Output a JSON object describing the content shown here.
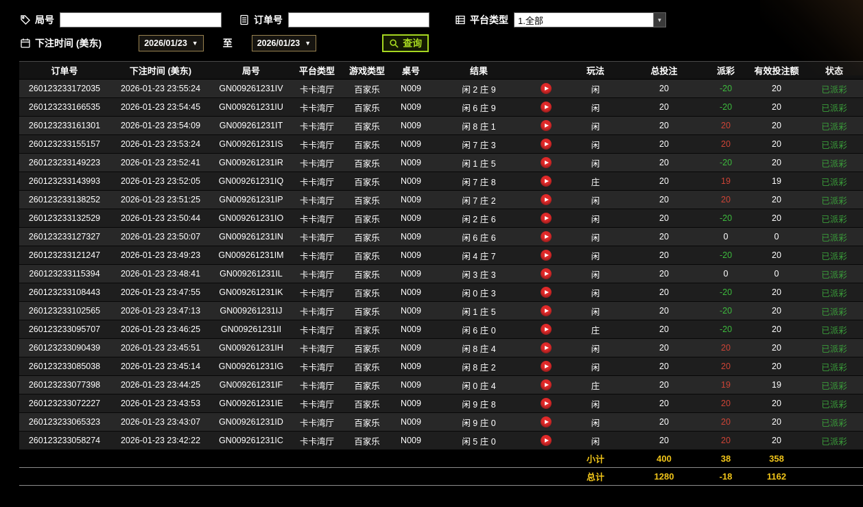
{
  "filters": {
    "round_label": "局号",
    "order_label": "订单号",
    "platform_label": "平台类型",
    "platform_value": "1.全部",
    "bet_time_label": "下注时间 (美东)",
    "date_from": "2026/01/23",
    "to_label": "至",
    "date_to": "2026/01/23",
    "query_label": "查询"
  },
  "table": {
    "headers": [
      "订单号",
      "下注时间 (美东)",
      "局号",
      "平台类型",
      "游戏类型",
      "桌号",
      "结果",
      "",
      "玩法",
      "总投注",
      "派彩",
      "有效投注额",
      "状态"
    ],
    "rows": [
      {
        "order": "260123233172035",
        "time": "2026-01-23 23:55:24",
        "round": "GN009261231IV",
        "platform": "卡卡湾厅",
        "game": "百家乐",
        "table_no": "N009",
        "result": "闲 2 庄 9",
        "play": "闲",
        "total": "20",
        "payout": "-20",
        "valid": "20",
        "status": "已派彩"
      },
      {
        "order": "260123233166535",
        "time": "2026-01-23 23:54:45",
        "round": "GN009261231IU",
        "platform": "卡卡湾厅",
        "game": "百家乐",
        "table_no": "N009",
        "result": "闲 6 庄 9",
        "play": "闲",
        "total": "20",
        "payout": "-20",
        "valid": "20",
        "status": "已派彩"
      },
      {
        "order": "260123233161301",
        "time": "2026-01-23 23:54:09",
        "round": "GN009261231IT",
        "platform": "卡卡湾厅",
        "game": "百家乐",
        "table_no": "N009",
        "result": "闲 8 庄 1",
        "play": "闲",
        "total": "20",
        "payout": "20",
        "valid": "20",
        "status": "已派彩"
      },
      {
        "order": "260123233155157",
        "time": "2026-01-23 23:53:24",
        "round": "GN009261231IS",
        "platform": "卡卡湾厅",
        "game": "百家乐",
        "table_no": "N009",
        "result": "闲 7 庄 3",
        "play": "闲",
        "total": "20",
        "payout": "20",
        "valid": "20",
        "status": "已派彩"
      },
      {
        "order": "260123233149223",
        "time": "2026-01-23 23:52:41",
        "round": "GN009261231IR",
        "platform": "卡卡湾厅",
        "game": "百家乐",
        "table_no": "N009",
        "result": "闲 1 庄 5",
        "play": "闲",
        "total": "20",
        "payout": "-20",
        "valid": "20",
        "status": "已派彩"
      },
      {
        "order": "260123233143993",
        "time": "2026-01-23 23:52:05",
        "round": "GN009261231IQ",
        "platform": "卡卡湾厅",
        "game": "百家乐",
        "table_no": "N009",
        "result": "闲 7 庄 8",
        "play": "庄",
        "total": "20",
        "payout": "19",
        "valid": "19",
        "status": "已派彩"
      },
      {
        "order": "260123233138252",
        "time": "2026-01-23 23:51:25",
        "round": "GN009261231IP",
        "platform": "卡卡湾厅",
        "game": "百家乐",
        "table_no": "N009",
        "result": "闲 7 庄 2",
        "play": "闲",
        "total": "20",
        "payout": "20",
        "valid": "20",
        "status": "已派彩"
      },
      {
        "order": "260123233132529",
        "time": "2026-01-23 23:50:44",
        "round": "GN009261231IO",
        "platform": "卡卡湾厅",
        "game": "百家乐",
        "table_no": "N009",
        "result": "闲 2 庄 6",
        "play": "闲",
        "total": "20",
        "payout": "-20",
        "valid": "20",
        "status": "已派彩"
      },
      {
        "order": "260123233127327",
        "time": "2026-01-23 23:50:07",
        "round": "GN009261231IN",
        "platform": "卡卡湾厅",
        "game": "百家乐",
        "table_no": "N009",
        "result": "闲 6 庄 6",
        "play": "闲",
        "total": "20",
        "payout": "0",
        "valid": "0",
        "status": "已派彩"
      },
      {
        "order": "260123233121247",
        "time": "2026-01-23 23:49:23",
        "round": "GN009261231IM",
        "platform": "卡卡湾厅",
        "game": "百家乐",
        "table_no": "N009",
        "result": "闲 4 庄 7",
        "play": "闲",
        "total": "20",
        "payout": "-20",
        "valid": "20",
        "status": "已派彩"
      },
      {
        "order": "260123233115394",
        "time": "2026-01-23 23:48:41",
        "round": "GN009261231IL",
        "platform": "卡卡湾厅",
        "game": "百家乐",
        "table_no": "N009",
        "result": "闲 3 庄 3",
        "play": "闲",
        "total": "20",
        "payout": "0",
        "valid": "0",
        "status": "已派彩"
      },
      {
        "order": "260123233108443",
        "time": "2026-01-23 23:47:55",
        "round": "GN009261231IK",
        "platform": "卡卡湾厅",
        "game": "百家乐",
        "table_no": "N009",
        "result": "闲 0 庄 3",
        "play": "闲",
        "total": "20",
        "payout": "-20",
        "valid": "20",
        "status": "已派彩"
      },
      {
        "order": "260123233102565",
        "time": "2026-01-23 23:47:13",
        "round": "GN009261231IJ",
        "platform": "卡卡湾厅",
        "game": "百家乐",
        "table_no": "N009",
        "result": "闲 1 庄 5",
        "play": "闲",
        "total": "20",
        "payout": "-20",
        "valid": "20",
        "status": "已派彩"
      },
      {
        "order": "260123233095707",
        "time": "2026-01-23 23:46:25",
        "round": "GN009261231II",
        "platform": "卡卡湾厅",
        "game": "百家乐",
        "table_no": "N009",
        "result": "闲 6 庄 0",
        "play": "庄",
        "total": "20",
        "payout": "-20",
        "valid": "20",
        "status": "已派彩"
      },
      {
        "order": "260123233090439",
        "time": "2026-01-23 23:45:51",
        "round": "GN009261231IH",
        "platform": "卡卡湾厅",
        "game": "百家乐",
        "table_no": "N009",
        "result": "闲 8 庄 4",
        "play": "闲",
        "total": "20",
        "payout": "20",
        "valid": "20",
        "status": "已派彩"
      },
      {
        "order": "260123233085038",
        "time": "2026-01-23 23:45:14",
        "round": "GN009261231IG",
        "platform": "卡卡湾厅",
        "game": "百家乐",
        "table_no": "N009",
        "result": "闲 8 庄 2",
        "play": "闲",
        "total": "20",
        "payout": "20",
        "valid": "20",
        "status": "已派彩"
      },
      {
        "order": "260123233077398",
        "time": "2026-01-23 23:44:25",
        "round": "GN009261231IF",
        "platform": "卡卡湾厅",
        "game": "百家乐",
        "table_no": "N009",
        "result": "闲 0 庄 4",
        "play": "庄",
        "total": "20",
        "payout": "19",
        "valid": "19",
        "status": "已派彩"
      },
      {
        "order": "260123233072227",
        "time": "2026-01-23 23:43:53",
        "round": "GN009261231IE",
        "platform": "卡卡湾厅",
        "game": "百家乐",
        "table_no": "N009",
        "result": "闲 9 庄 8",
        "play": "闲",
        "total": "20",
        "payout": "20",
        "valid": "20",
        "status": "已派彩"
      },
      {
        "order": "260123233065323",
        "time": "2026-01-23 23:43:07",
        "round": "GN009261231ID",
        "platform": "卡卡湾厅",
        "game": "百家乐",
        "table_no": "N009",
        "result": "闲 9 庄 0",
        "play": "闲",
        "total": "20",
        "payout": "20",
        "valid": "20",
        "status": "已派彩"
      },
      {
        "order": "260123233058274",
        "time": "2026-01-23 23:42:22",
        "round": "GN009261231IC",
        "platform": "卡卡湾厅",
        "game": "百家乐",
        "table_no": "N009",
        "result": "闲 5 庄 0",
        "play": "闲",
        "total": "20",
        "payout": "20",
        "valid": "20",
        "status": "已派彩"
      }
    ],
    "subtotal": {
      "label": "小计",
      "total_bet": "400",
      "payout": "38",
      "valid_bet": "358"
    },
    "grand_total": {
      "label": "总计",
      "total_bet": "1280",
      "payout": "-18",
      "valid_bet": "1162"
    }
  },
  "colors": {
    "win_red": "#cf4436",
    "lose_green": "#3dbb3d",
    "status_green": "#3a9e3a",
    "summary_yellow": "#f0c419",
    "query_green": "#a6d820",
    "play_red": "#e02a2a",
    "date_border": "#9a8350"
  }
}
